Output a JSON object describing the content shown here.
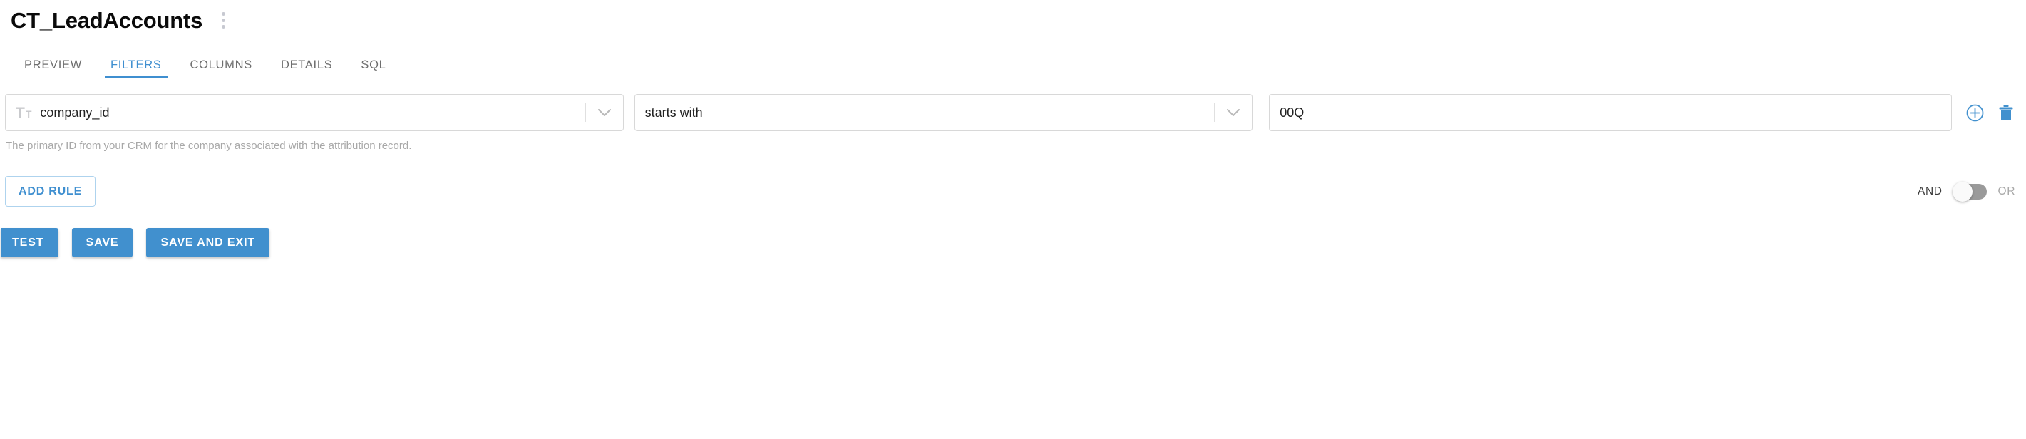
{
  "header": {
    "title": "CT_LeadAccounts",
    "menu_icon": "kebab-menu-icon"
  },
  "tabs": [
    {
      "label": "PREVIEW",
      "active": false
    },
    {
      "label": "FILTERS",
      "active": true
    },
    {
      "label": "COLUMNS",
      "active": false
    },
    {
      "label": "DETAILS",
      "active": false
    },
    {
      "label": "SQL",
      "active": false
    }
  ],
  "filter": {
    "field": {
      "value": "company_id",
      "type_icon": "text-type-icon",
      "chevron_icon": "chevron-down-icon"
    },
    "operator": {
      "value": "starts with",
      "chevron_icon": "chevron-down-icon"
    },
    "value_input": {
      "value": "00Q",
      "placeholder": ""
    },
    "actions": {
      "add_icon": "circle-plus-icon",
      "delete_icon": "trash-icon"
    },
    "helper_text": "The primary ID from your CRM for the company associated with the attribution record."
  },
  "rule_bar": {
    "add_rule_label": "ADD RULE",
    "conjunction": {
      "left_label": "AND",
      "right_label": "OR",
      "selected": "AND"
    }
  },
  "actions": {
    "test_label": "TEST",
    "save_label": "SAVE",
    "save_exit_label": "SAVE AND EXIT"
  },
  "colors": {
    "accent_blue": "#4190ce",
    "tab_active": "#3f8fd0",
    "helper_gray": "#a8a8a8",
    "border_gray": "#d8d8d8"
  }
}
